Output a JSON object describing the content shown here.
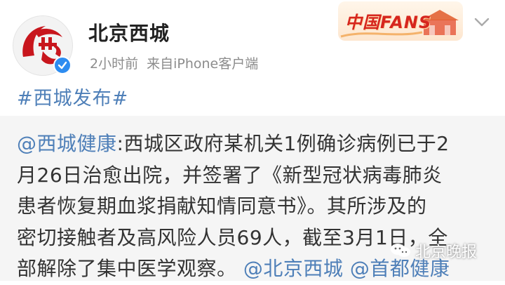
{
  "account": {
    "name": "北京西城",
    "meta_time": "2小时前",
    "meta_source": "来自iPhone客户端"
  },
  "badge": {
    "text": "中国FANS"
  },
  "post": {
    "topic": "#西城发布#",
    "lines": [
      {
        "mention": "@西城健康",
        "text": ":西城区政府某机关1例确诊病例已于2"
      },
      {
        "text": "月26日治愈出院，并签署了《新型冠状病毒肺炎"
      },
      {
        "text": "患者恢复期血浆捐献知情同意书》。其所涉及的"
      },
      {
        "text": "密切接触者及高风险人员69人，截至3月1日，全"
      },
      {
        "text": "部解除了集中医学观察。",
        "mention2": "@北京西城",
        "mention3": "@首都健康"
      }
    ]
  },
  "watermark": {
    "text": "北京晚报"
  },
  "colors": {
    "link": "#4e7fb8",
    "verified": "#2d8cf0",
    "badge_red": "#d6261e"
  }
}
